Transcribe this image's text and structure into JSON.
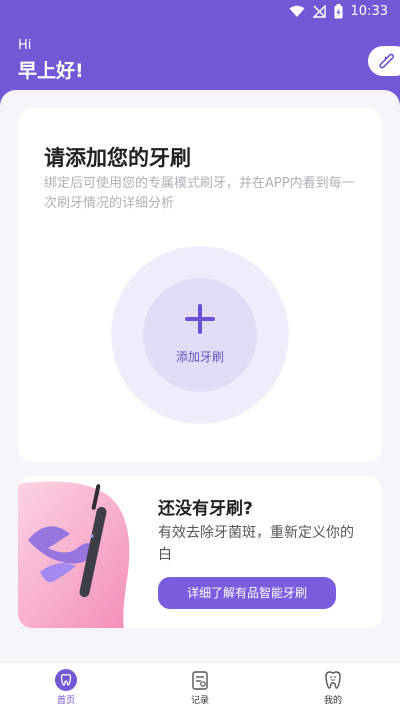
{
  "status_bar": {
    "time": "10:33"
  },
  "header": {
    "greeting_small": "Hi",
    "greeting_main": "早上好!"
  },
  "add_card": {
    "title": "请添加您的牙刷",
    "description": "绑定后可使用您的专属模式刷牙，并在APP内看到每一次刷牙情况的详细分析",
    "add_button_label": "添加牙刷"
  },
  "promo_card": {
    "title": "还没有牙刷?",
    "description": "有效去除牙菌斑，重新定义你的白",
    "button_label": "详细了解有品智能牙刷"
  },
  "bottom_nav": {
    "items": [
      {
        "label": "首页",
        "icon": "tooth-home-icon",
        "active": true
      },
      {
        "label": "记录",
        "icon": "record-icon",
        "active": false
      },
      {
        "label": "我的",
        "icon": "profile-tooth-icon",
        "active": false
      }
    ]
  },
  "colors": {
    "accent": "#7358d6",
    "button": "#7a5ddc",
    "circle_outer": "#efecfb",
    "circle_inner": "#e2dcf7"
  }
}
